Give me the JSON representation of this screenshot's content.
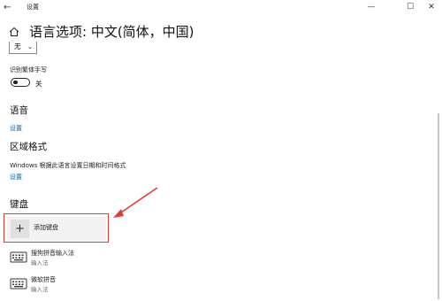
{
  "window": {
    "app_title": "设置",
    "back_glyph": "←",
    "min_glyph": "—",
    "max_glyph": "☐",
    "close_glyph": "✕"
  },
  "page": {
    "title": "语言选项: 中文(简体，中国)"
  },
  "handwriting": {
    "dropdown_value": "无",
    "dropdown_chevron": "⌄",
    "toggle_label": "识别繁体手写",
    "toggle_state": "关"
  },
  "speech": {
    "heading": "语音",
    "settings_link": "设置"
  },
  "region": {
    "heading": "区域格式",
    "description": "Windows 根据此语言设置日期和时间格式",
    "settings_link": "设置"
  },
  "keyboard": {
    "heading": "键盘",
    "add_label": "添加键盘",
    "add_glyph": "+",
    "items": [
      {
        "name": "搜狗拼音输入法",
        "sub": "输入法"
      },
      {
        "name": "微软拼音",
        "sub": "输入法"
      }
    ]
  },
  "colors": {
    "accent_link": "#0063b1",
    "annotation_red": "#e03c31"
  }
}
